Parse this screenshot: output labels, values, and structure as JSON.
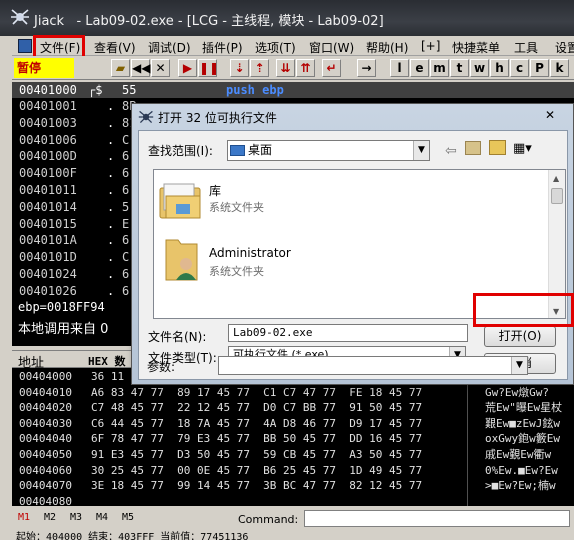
{
  "window": {
    "title": "Jiack   - Lab09-02.exe - [LCG - 主线程, 模块 - Lab09-02]"
  },
  "menu": [
    "文件(F)",
    "查看(V)",
    "调试(D)",
    "插件(P)",
    "选项(T)",
    "窗口(W)",
    "帮助(H)",
    "[+]",
    "快捷菜单",
    "工具",
    "设置"
  ],
  "toolbar": {
    "pause": "暂停",
    "letters": [
      "l",
      "e",
      "m",
      "t",
      "w",
      "h",
      "c",
      "P",
      "k"
    ]
  },
  "disasm": {
    "first": {
      "addr": "00401000",
      "mark": "┌$",
      "bytes": "55",
      "asm": "push ebp"
    },
    "rows": [
      [
        "00401001",
        "."
      ],
      [
        "00401003",
        "."
      ],
      [
        "00401006",
        "."
      ],
      [
        "0040100D",
        "."
      ],
      [
        "0040100F",
        "."
      ],
      [
        "00401011",
        "."
      ],
      [
        "00401014",
        "."
      ],
      [
        "00401015",
        "."
      ],
      [
        "0040101A",
        "."
      ],
      [
        "0040101D",
        "."
      ],
      [
        "00401024",
        "."
      ],
      [
        "00401026",
        "."
      ]
    ],
    "byte_frags": [
      "8B",
      "81",
      "C",
      "6",
      "6",
      "6",
      "5",
      "E",
      "6",
      "C",
      "6",
      "6"
    ]
  },
  "registers": {
    "line1": "ebp=0018FF94",
    "line2": "本地调用来自 0"
  },
  "hex": {
    "header": {
      "addr": "地址",
      "hex": "HEX 数"
    },
    "rows": [
      {
        "a": "00404000",
        "h": "36 11",
        "t": ""
      },
      {
        "a": "00404010",
        "h": "A6 83 47 77  89 17 45 77  C1 C7 47 77  FE 18 45 77",
        "t": "Gw?Ew燉Gw?"
      },
      {
        "a": "00404020",
        "h": "C7 48 45 77  22 12 45 77  D0 C7 BB 77  91 50 45 77",
        "t": "荒Ew\"曝Ew星杖"
      },
      {
        "a": "00404030",
        "h": "C6 44 45 77  18 7A 45 77  4A D8 46 77  D9 17 45 77",
        "t": "艱Ew■zEwJ鉉w"
      },
      {
        "a": "00404040",
        "h": "6F 78 47 77  79 E3 45 77  BB 50 45 77  DD 16 45 77",
        "t": "oxGwy鉋w籔Ew"
      },
      {
        "a": "00404050",
        "h": "91 E3 45 77  D3 50 45 77  59 CB 45 77  A3 50 45 77",
        "t": "戚Ew覲Ew衢w"
      },
      {
        "a": "00404060",
        "h": "30 25 45 77  00 0E 45 77  B6 25 45 77  1D 49 45 77",
        "t": "0%Ew.■Ew?Ew"
      },
      {
        "a": "00404070",
        "h": "3E 18 45 77  99 14 45 77  3B BC 47 77  82 12 45 77",
        "t": ">■Ew?Ew;楠w"
      },
      {
        "a": "00404080",
        "h": "",
        "t": ""
      }
    ]
  },
  "status": {
    "tabs": [
      "M1",
      "M2",
      "M3",
      "M4",
      "M5"
    ],
    "command_label": "Command:",
    "bottom": "起始：404000  结束：403FFF  当前值：77451136"
  },
  "dialog": {
    "title": "打开 32 位可执行文件",
    "lookin_label": "查找范围(I):",
    "lookin_value": "桌面",
    "items": [
      {
        "name": "库",
        "sub": "系统文件夹"
      },
      {
        "name": "Administrator",
        "sub": "系统文件夹"
      }
    ],
    "filename_label": "文件名(N):",
    "filename_value": "Lab09-02.exe",
    "filetype_label": "文件类型(T):",
    "filetype_value": "可执行文件 (*.exe)",
    "args_label": "参数:",
    "open_button": "打开(O)",
    "cancel_button": "取消",
    "close_glyph": "✕"
  },
  "colors": {
    "highlight": "#e00000",
    "pause_bg": "#ffff00",
    "disasm_bg": "#000000"
  }
}
